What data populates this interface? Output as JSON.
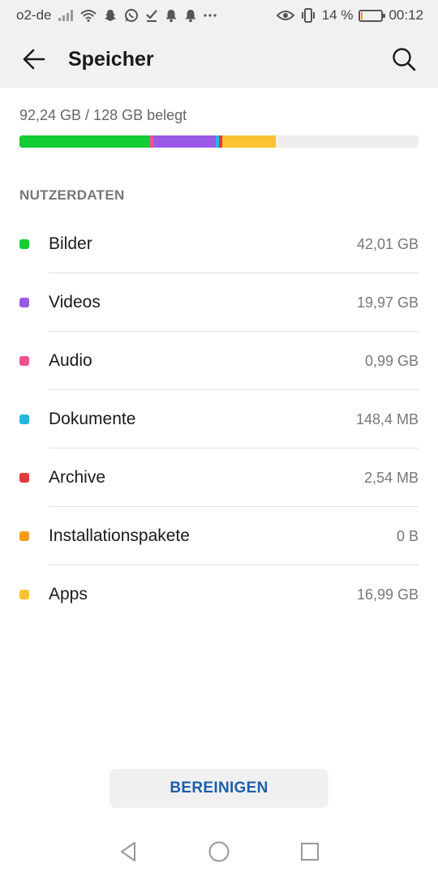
{
  "status_bar": {
    "carrier": "o2-de",
    "battery_percent": "14 %",
    "battery_level": 0.14,
    "time": "00:12",
    "left_icons": [
      "signal-icon",
      "wifi-icon",
      "snapchat-icon",
      "whatsapp-icon",
      "check-icon",
      "bell-icon",
      "bell-icon",
      "more-icon"
    ],
    "right_icons": [
      "eye-icon",
      "vibrate-icon",
      "battery-icon"
    ]
  },
  "app_bar": {
    "title": "Speicher",
    "back_icon": "arrow-left-icon",
    "search_icon": "search-icon"
  },
  "usage": {
    "summary": "92,24 GB / 128 GB belegt",
    "segments": [
      {
        "category": "Bilder",
        "fraction": 0.3282,
        "color": "#11cc33"
      },
      {
        "category": "Audio",
        "fraction": 0.0077,
        "color": "#f0528c"
      },
      {
        "category": "Videos",
        "fraction": 0.156,
        "color": "#9b59e8"
      },
      {
        "category": "Dokumente",
        "fraction": 0.009,
        "color": "#22b8e0"
      },
      {
        "category": "Archive",
        "fraction": 0.008,
        "color": "#e63939"
      },
      {
        "category": "Apps",
        "fraction": 0.1327,
        "color": "#fcc232"
      }
    ]
  },
  "section": {
    "title": "NUTZERDATEN"
  },
  "categories": [
    {
      "label": "Bilder",
      "size": "42,01 GB",
      "color": "#11cc33"
    },
    {
      "label": "Videos",
      "size": "19,97 GB",
      "color": "#9b59e8"
    },
    {
      "label": "Audio",
      "size": "0,99 GB",
      "color": "#f0528c"
    },
    {
      "label": "Dokumente",
      "size": "148,4 MB",
      "color": "#22b8e0"
    },
    {
      "label": "Archive",
      "size": "2,54 MB",
      "color": "#e63939"
    },
    {
      "label": "Installationspakete",
      "size": "0 B",
      "color": "#f79a14"
    },
    {
      "label": "Apps",
      "size": "16,99 GB",
      "color": "#fcc232"
    }
  ],
  "actions": {
    "clean_label": "BEREINIGEN"
  },
  "nav_bar": {
    "icons": [
      "back-triangle-icon",
      "home-circle-icon",
      "recents-square-icon"
    ]
  }
}
